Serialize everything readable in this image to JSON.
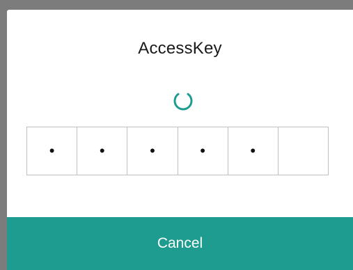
{
  "dialog": {
    "title": "AccessKey",
    "spinner_icon": "loading-spinner-icon",
    "accent_color": "#1e9c8f",
    "pin": {
      "cells": [
        "•",
        "•",
        "•",
        "•",
        "•",
        ""
      ],
      "filled_count": 5,
      "total_count": 6
    },
    "cancel_label": "Cancel"
  }
}
